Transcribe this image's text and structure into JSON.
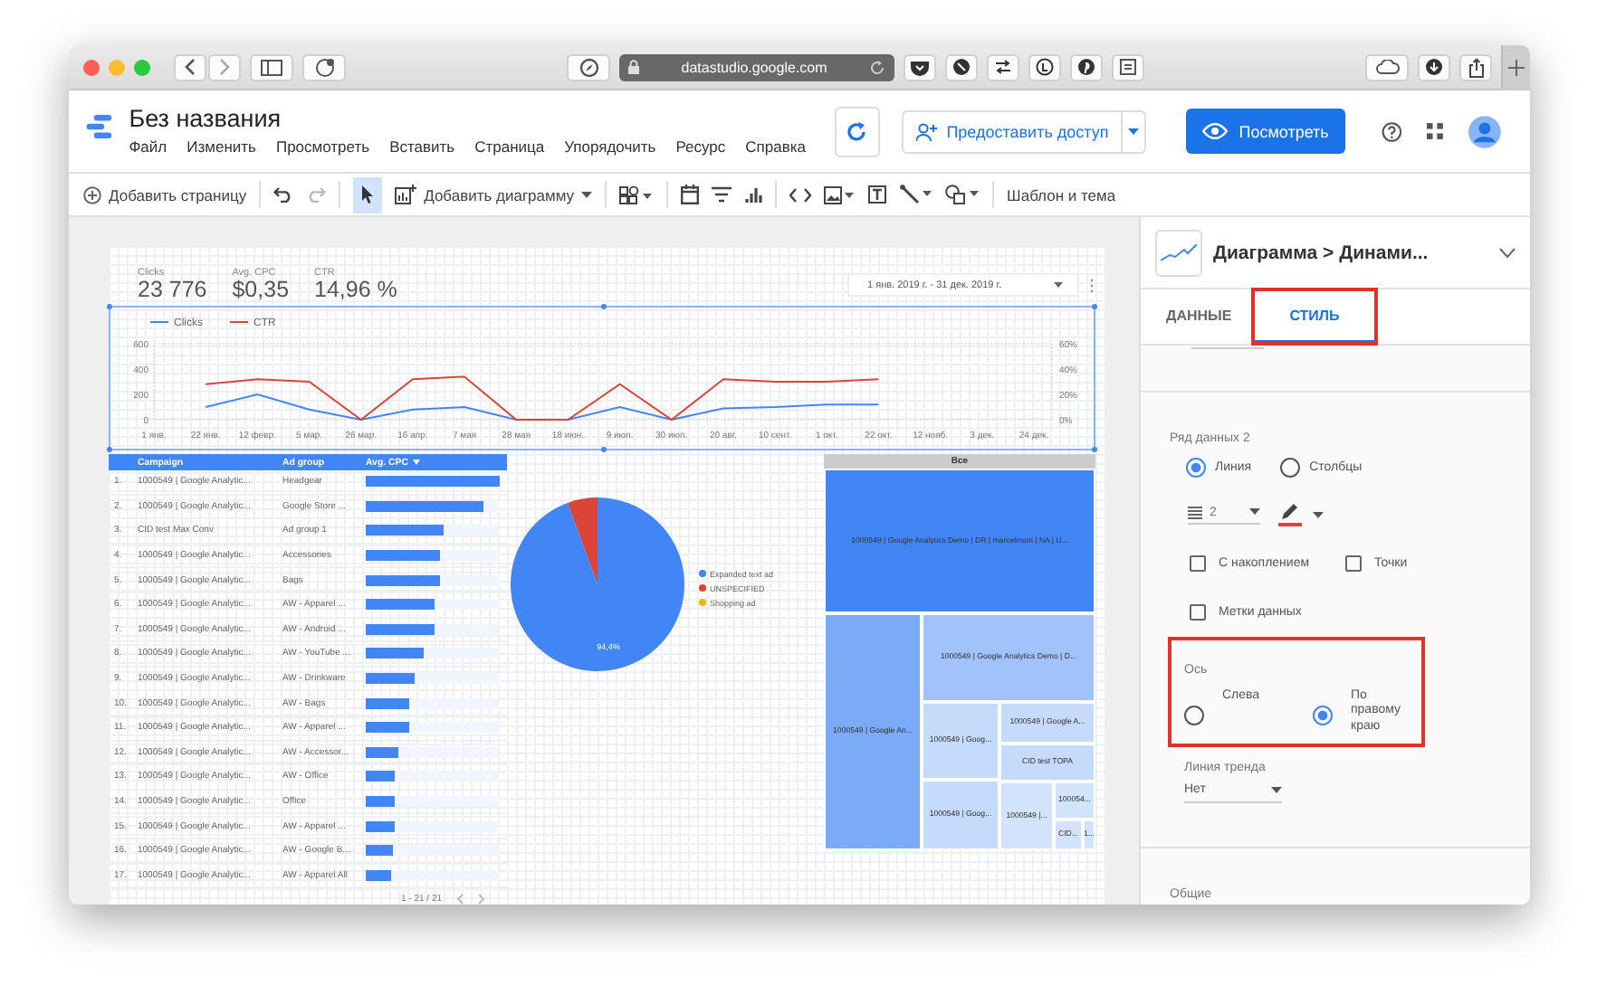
{
  "browser": {
    "url": "datastudio.google.com"
  },
  "app": {
    "title": "Без названия",
    "menu": [
      "Файл",
      "Изменить",
      "Просмотреть",
      "Вставить",
      "Страница",
      "Упорядочить",
      "Ресурс",
      "Справка"
    ],
    "share_button": "Предоставить доступ",
    "view_button": "Посмотреть"
  },
  "toolbar": {
    "add_page": "Добавить страницу",
    "add_chart": "Добавить диаграмму",
    "theme": "Шаблон и тема",
    "pointer_selected": true
  },
  "scorecards": [
    {
      "label": "Clicks",
      "value": "23 776"
    },
    {
      "label": "Avg. CPC",
      "value": "$0,35"
    },
    {
      "label": "CTR",
      "value": "14,96 %"
    }
  ],
  "date_range": "1 янв. 2019 г. - 31 дек. 2019 г.",
  "time_chart": {
    "selected": true,
    "chart_data": {
      "type": "line",
      "legend": "top",
      "y2lim": [
        0,
        60
      ],
      "y2ticks": [
        {
          "value": 0,
          "label": "0%"
        },
        {
          "value": 20,
          "label": "20%"
        },
        {
          "value": 40,
          "label": "40%"
        },
        {
          "value": 60,
          "label": "60%"
        }
      ],
      "x": [
        "1 янв.",
        "22 янв.",
        "12 февр.",
        "5 мар.",
        "26 мар.",
        "16 апр.",
        "7 мая",
        "28 мая",
        "18 июн.",
        "9 июл.",
        "30 июл.",
        "20 авг.",
        "10 сент.",
        "1 окт.",
        "22 окт.",
        "12 нояб.",
        "3 дек.",
        "24 дек."
      ],
      "ylim": [
        0,
        600
      ],
      "yticks": [
        0,
        200,
        400,
        600
      ],
      "series": [
        {
          "name": "Clicks",
          "color": "#4285f4",
          "values": [
            null,
            100,
            200,
            80,
            0,
            80,
            100,
            0,
            0,
            100,
            0,
            90,
            100,
            120,
            120,
            null,
            null,
            null
          ]
        },
        {
          "name": "CTR",
          "color": "#db4437",
          "axis": "y2",
          "values": [
            null,
            28,
            32,
            30,
            0,
            32,
            34,
            0,
            0,
            28,
            0,
            32,
            30,
            30,
            32,
            null,
            null,
            null
          ]
        }
      ]
    }
  },
  "table": {
    "columns": [
      "Campaign",
      "Ad group",
      "Avg. CPC"
    ],
    "pager": "1 - 21 / 21",
    "rows": [
      {
        "index": "1.",
        "campaign": "1000549 | Google Analytic...",
        "ad_group": "Headgear",
        "level": 1.0
      },
      {
        "index": "2.",
        "campaign": "1000549 | Google Analytic...",
        "ad_group": "Google Store ...",
        "level": 0.88
      },
      {
        "index": "3.",
        "campaign": "CID test Max Conv",
        "ad_group": "Ad group 1",
        "level": 0.58
      },
      {
        "index": "4.",
        "campaign": "1000549 | Google Analytic...",
        "ad_group": "Accessories",
        "level": 0.56
      },
      {
        "index": "5.",
        "campaign": "1000549 | Google Analytic...",
        "ad_group": "Bags",
        "level": 0.55
      },
      {
        "index": "6.",
        "campaign": "1000549 | Google Analytic...",
        "ad_group": "AW - Apparel ...",
        "level": 0.52
      },
      {
        "index": "7.",
        "campaign": "1000549 | Google Analytic...",
        "ad_group": "AW - Android ...",
        "level": 0.51
      },
      {
        "index": "8.",
        "campaign": "1000549 | Google Analytic...",
        "ad_group": "AW - YouTube ...",
        "level": 0.43
      },
      {
        "index": "9.",
        "campaign": "1000549 | Google Analytic...",
        "ad_group": "AW - Drinkware",
        "level": 0.36
      },
      {
        "index": "10.",
        "campaign": "1000549 | Google Analytic...",
        "ad_group": "AW - Bags",
        "level": 0.32
      },
      {
        "index": "11.",
        "campaign": "1000549 | Google Analytic...",
        "ad_group": "AW - Apparel ...",
        "level": 0.32
      },
      {
        "index": "12.",
        "campaign": "1000549 | Google Analytic...",
        "ad_group": "AW - Accessor...",
        "level": 0.24
      },
      {
        "index": "13.",
        "campaign": "1000549 | Google Analytic...",
        "ad_group": "AW - Office",
        "level": 0.22
      },
      {
        "index": "14.",
        "campaign": "1000549 | Google Analytic...",
        "ad_group": "Office",
        "level": 0.21
      },
      {
        "index": "15.",
        "campaign": "1000549 | Google Analytic...",
        "ad_group": "AW - Apparel ...",
        "level": 0.21
      },
      {
        "index": "16.",
        "campaign": "1000549 | Google Analytic...",
        "ad_group": "AW - Google B...",
        "level": 0.2
      },
      {
        "index": "17.",
        "campaign": "1000549 | Google Analytic...",
        "ad_group": "AW - Apparel All",
        "level": 0.19
      }
    ]
  },
  "pie": {
    "chart_data": {
      "type": "pie",
      "legend": "right",
      "categories": [
        "Expanded text ad",
        "UNSPECIFIED",
        "Shopping ad"
      ],
      "colors": [
        "#4285f4",
        "#db4437",
        "#f4b400"
      ],
      "values": [
        94.4,
        5.6,
        0
      ],
      "value_labels": [
        "94,4%",
        null,
        null
      ]
    }
  },
  "treemap": {
    "header": "Все",
    "cells": [
      {
        "label": "1000549 | Google Analytics Demo | DR | marcelinom | NA | U...",
        "color": "#4285f4"
      },
      {
        "label": "1000549 | Google An...",
        "color": "#7baaf7"
      },
      {
        "label": "1000549 | Google Analytics Demo | D...",
        "color": "#a1c2fa"
      },
      {
        "label": "1000549 | Goog...",
        "color": "#c6dafc"
      },
      {
        "label": "1000549 | Google A...",
        "color": "#c6dafc"
      },
      {
        "label": "CID test TOPA",
        "color": "#c6dafc"
      },
      {
        "label": "1000549 | Goog...",
        "color": "#c6dafc"
      },
      {
        "label": "1000549 |...",
        "color": "#d2e3fc"
      },
      {
        "label": "100054...",
        "color": "#d2e3fc"
      },
      {
        "label": "CID...",
        "color": "#d2e3fc"
      },
      {
        "label": "1...",
        "color": "#d2e3fc"
      }
    ]
  },
  "panel": {
    "title": "Диаграмма > Динами...",
    "tabs": [
      {
        "label": "ДАННЫЕ",
        "selected": false,
        "highlighted": false
      },
      {
        "label": "СТИЛЬ",
        "selected": true,
        "highlighted": true
      }
    ],
    "series_label": "Ряд данных 2",
    "type_options": [
      {
        "label": "Линия",
        "selected": true
      },
      {
        "label": "Столбцы",
        "selected": false
      }
    ],
    "line_style": {
      "weight": "2",
      "color": "#db4437"
    },
    "checkboxes": [
      {
        "label": "С накоплением",
        "checked": false
      },
      {
        "label": "Точки",
        "checked": false
      },
      {
        "label": "Метки данных",
        "checked": false
      }
    ],
    "axis": {
      "label": "Ось",
      "highlighted": true,
      "options": [
        {
          "label": "Слева",
          "selected": false
        },
        {
          "label": "По правому краю",
          "selected": true
        }
      ]
    },
    "trend": {
      "label": "Линия тренда",
      "value": "Нет"
    },
    "next_section": "Общие"
  }
}
